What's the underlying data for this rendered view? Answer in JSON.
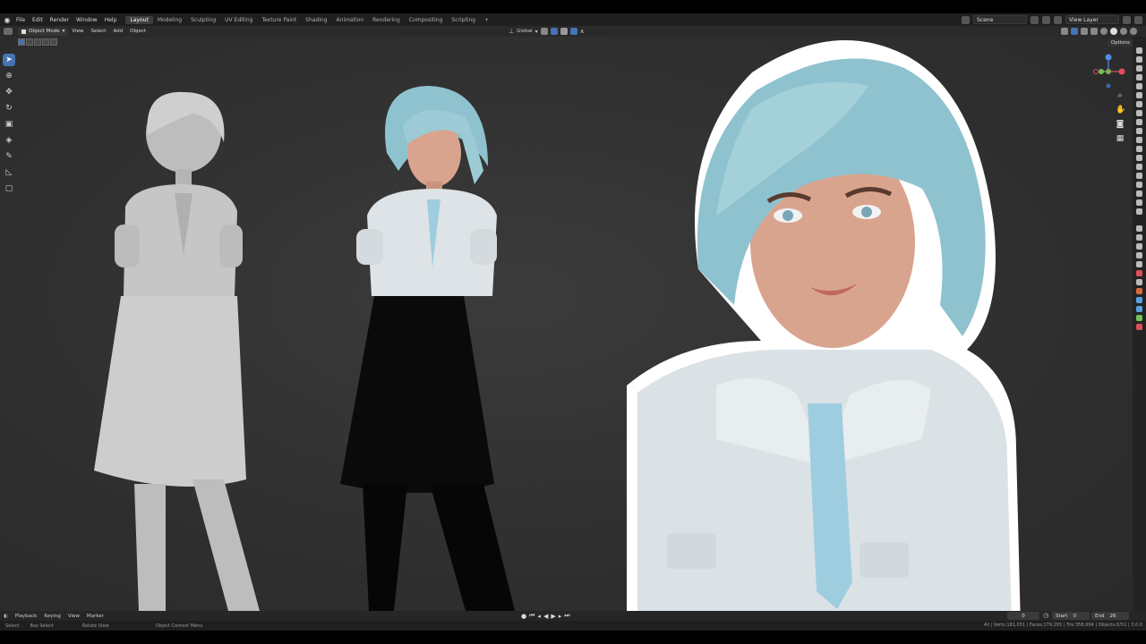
{
  "menu": [
    "File",
    "Edit",
    "Render",
    "Window",
    "Help"
  ],
  "workspaces": [
    {
      "label": "Layout",
      "active": true
    },
    {
      "label": "Modeling",
      "active": false
    },
    {
      "label": "Sculpting",
      "active": false
    },
    {
      "label": "UV Editing",
      "active": false
    },
    {
      "label": "Texture Paint",
      "active": false
    },
    {
      "label": "Shading",
      "active": false
    },
    {
      "label": "Animation",
      "active": false
    },
    {
      "label": "Rendering",
      "active": false
    },
    {
      "label": "Compositing",
      "active": false
    },
    {
      "label": "Scripting",
      "active": false
    }
  ],
  "scene": "Scene",
  "view_layer": "View Layer",
  "viewport_header": {
    "mode": "Object Mode",
    "menus": [
      "View",
      "Select",
      "Add",
      "Object"
    ],
    "orientation": "Global",
    "options": "Options"
  },
  "timeline": {
    "menus": [
      "Playback",
      "Keying",
      "View",
      "Marker"
    ],
    "current_frame": "0",
    "start_label": "Start",
    "start": "0",
    "end_label": "End",
    "end": "26"
  },
  "status": {
    "items": [
      "Select",
      "Box Select",
      "Rotate View",
      "Object Context Menu"
    ],
    "stats": "All | Verts:181,031 | Faces:179,295 | Tris:358,604 | Objects:0/51 | 3.0.0"
  },
  "colors": {
    "accent": "#4772b3",
    "hair": "#8fc2cf",
    "skin": "#d9a48e",
    "shirt": "#dde3e6",
    "tie": "#9fcde0",
    "skirt": "#0a0a0a",
    "clay": "#c8c8c8"
  }
}
